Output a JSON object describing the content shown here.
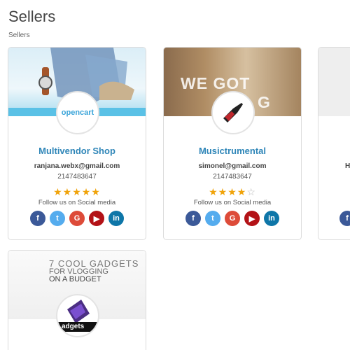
{
  "page": {
    "title": "Sellers",
    "breadcrumb": "Sellers"
  },
  "sellers": [
    {
      "name": "Multivendor Shop",
      "email": "ranjana.webx@gmail.com",
      "phone": "2147483647",
      "rating": 5,
      "follow_text": "Follow us on Social media",
      "logo_text": "opencart"
    },
    {
      "name": "Musictrumental",
      "email": "simonel@gmail.com",
      "phone": "2147483647",
      "rating": 4,
      "follow_text": "Follow us on Social media",
      "banner_text_a": "WE GOT",
      "banner_text_b": "G"
    },
    {
      "email_partial": "H"
    },
    {
      "banner_lines": [
        "7 COOL GADGETS",
        "FOR VLOGGING",
        "ON A BUDGET"
      ],
      "logo_text": "adgets"
    }
  ],
  "social_icons": [
    "facebook-icon",
    "twitter-icon",
    "google-plus-icon",
    "youtube-icon",
    "linkedin-icon"
  ],
  "colors": {
    "link": "#2f86b8",
    "star": "#f0a30a",
    "facebook": "#3b5998",
    "twitter": "#55acee",
    "google": "#dd4b39",
    "youtube": "#b31217",
    "linkedin": "#0e76a8"
  }
}
